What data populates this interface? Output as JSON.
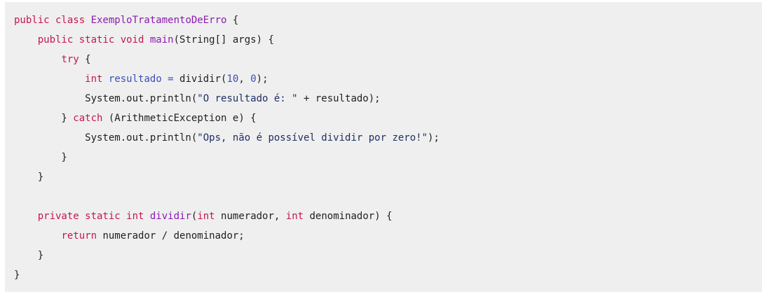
{
  "code": {
    "lines": [
      [
        {
          "t": "public class ",
          "c": "kw"
        },
        {
          "t": "ExemploTratamentoDeErro",
          "c": "fn"
        },
        {
          "t": " {",
          "c": "plain"
        }
      ],
      [
        {
          "t": "    public static void ",
          "c": "kw"
        },
        {
          "t": "main",
          "c": "fn"
        },
        {
          "t": "(String[] args) {",
          "c": "plain"
        }
      ],
      [
        {
          "t": "        ",
          "c": "plain"
        },
        {
          "t": "try",
          "c": "kw"
        },
        {
          "t": " {",
          "c": "plain"
        }
      ],
      [
        {
          "t": "            ",
          "c": "plain"
        },
        {
          "t": "int",
          "c": "kw"
        },
        {
          "t": " ",
          "c": "plain"
        },
        {
          "t": "resultado",
          "c": "var"
        },
        {
          "t": " = ",
          "c": "var"
        },
        {
          "t": "dividir(",
          "c": "plain"
        },
        {
          "t": "10",
          "c": "num"
        },
        {
          "t": ", ",
          "c": "plain"
        },
        {
          "t": "0",
          "c": "num"
        },
        {
          "t": ");",
          "c": "plain"
        }
      ],
      [
        {
          "t": "            System.out.println(",
          "c": "plain"
        },
        {
          "t": "\"O resultado é: \"",
          "c": "str"
        },
        {
          "t": " + resultado);",
          "c": "plain"
        }
      ],
      [
        {
          "t": "        } ",
          "c": "plain"
        },
        {
          "t": "catch",
          "c": "kw"
        },
        {
          "t": " (ArithmeticException e) {",
          "c": "plain"
        }
      ],
      [
        {
          "t": "            System.out.println(",
          "c": "plain"
        },
        {
          "t": "\"Ops, não é possível dividir por zero!\"",
          "c": "str"
        },
        {
          "t": ");",
          "c": "plain"
        }
      ],
      [
        {
          "t": "        }",
          "c": "plain"
        }
      ],
      [
        {
          "t": "    }",
          "c": "plain"
        }
      ],
      [
        {
          "t": "",
          "c": "plain"
        }
      ],
      [
        {
          "t": "    ",
          "c": "plain"
        },
        {
          "t": "private static int ",
          "c": "kw"
        },
        {
          "t": "dividir",
          "c": "fn"
        },
        {
          "t": "(",
          "c": "plain"
        },
        {
          "t": "int",
          "c": "kw"
        },
        {
          "t": " numerador, ",
          "c": "plain"
        },
        {
          "t": "int",
          "c": "kw"
        },
        {
          "t": " denominador) {",
          "c": "plain"
        }
      ],
      [
        {
          "t": "        ",
          "c": "plain"
        },
        {
          "t": "return",
          "c": "kw"
        },
        {
          "t": " numerador / denominador;",
          "c": "plain"
        }
      ],
      [
        {
          "t": "    }",
          "c": "plain"
        }
      ],
      [
        {
          "t": "}",
          "c": "plain"
        }
      ]
    ]
  }
}
